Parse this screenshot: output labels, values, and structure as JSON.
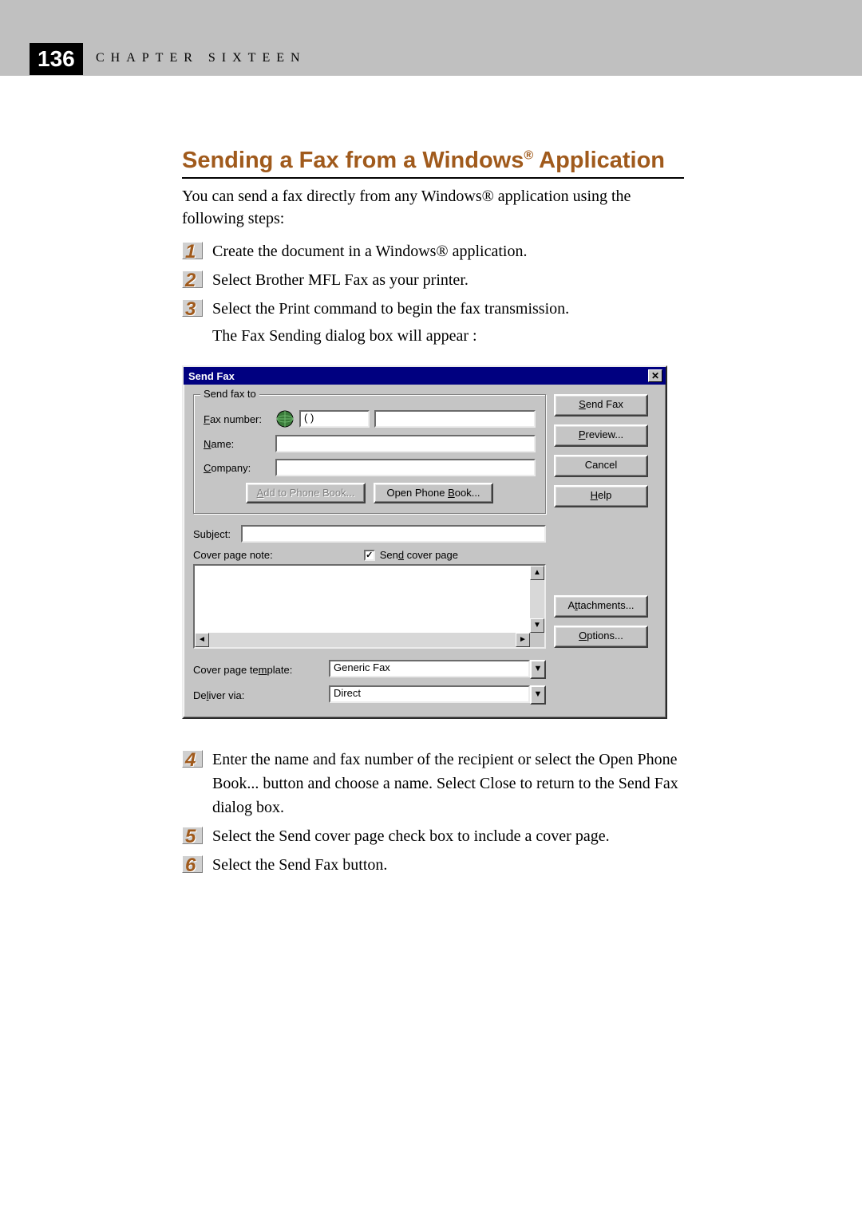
{
  "page": {
    "number": "136",
    "chapter_label": "CHAPTER SIXTEEN"
  },
  "section": {
    "title_pre": "Sending a Fax from a Windows",
    "title_sup": "®",
    "title_post": " Application",
    "intro": "You can send a fax directly from any Windows® application using the following steps:"
  },
  "steps_top": [
    {
      "num": "1",
      "text": "Create the document in a Windows® application."
    },
    {
      "num": "2",
      "text": "Select Brother MFL Fax as your printer."
    },
    {
      "num": "3",
      "text": "Select the Print command to begin the fax transmission.",
      "sub": "The Fax Sending dialog box will appear :"
    }
  ],
  "dialog": {
    "title": "Send Fax",
    "group_legend": "Send fax to",
    "labels": {
      "fax_number": "Fax number:",
      "name": "Name:",
      "company": "Company:",
      "subject": "Subject:",
      "cover_page_note": "Cover page note:",
      "send_cover_page": "Send cover page",
      "cover_page_template": "Cover page template:",
      "deliver_via": "Deliver via:"
    },
    "underlines": {
      "fax_number": "F",
      "name": "N",
      "company": "C",
      "send_cover_page": "d",
      "cover_page_template": "m",
      "deliver_via": "l"
    },
    "fields": {
      "fax_number_value": "(     )",
      "name_value": "",
      "company_value": "",
      "subject_value": "",
      "cover_page_note_value": "",
      "send_cover_page_checked": "✓",
      "cover_page_template_value": "Generic Fax",
      "deliver_via_value": "Direct"
    },
    "buttons": {
      "add_to_phone_book": "Add to Phone Book...",
      "open_phone_book": "Open Phone Book...",
      "send_fax": "Send Fax",
      "preview": "Preview...",
      "cancel": "Cancel",
      "help": "Help",
      "attachments": "Attachments...",
      "options": "Options..."
    },
    "button_underlines": {
      "add_to_phone_book": "A",
      "open_phone_book": "B",
      "send_fax": "S",
      "preview": "P",
      "help": "H",
      "attachments": "t",
      "options": "O"
    }
  },
  "steps_bottom": [
    {
      "num": "4",
      "text": "Enter the name and fax number of the recipient or select the Open Phone Book... button and choose a name.  Select Close to return to the Send Fax dialog box."
    },
    {
      "num": "5",
      "text": "Select the Send cover page check box to include a cover page."
    },
    {
      "num": "6",
      "text": "Select the Send Fax button."
    }
  ]
}
